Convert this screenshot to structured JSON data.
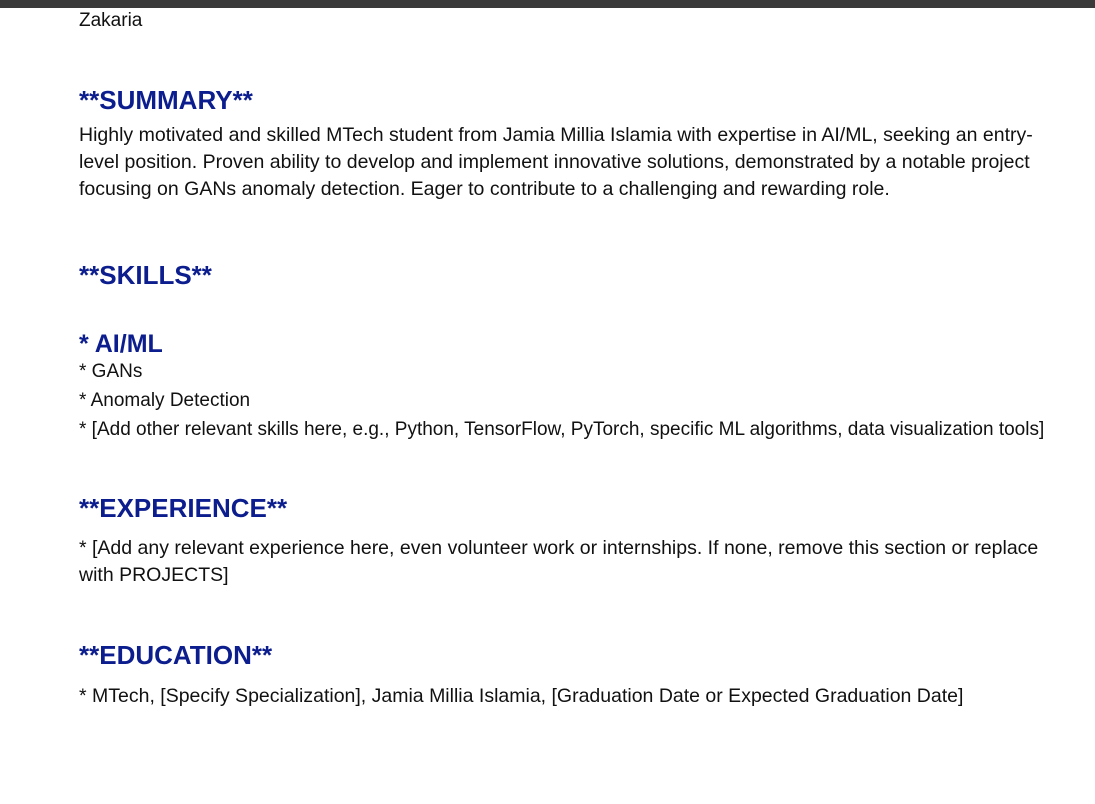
{
  "header": {
    "name": "Zakaria"
  },
  "summary": {
    "heading": "**SUMMARY**",
    "text": "Highly motivated and skilled MTech student from Jamia Millia Islamia with expertise in AI/ML, seeking an entry-level position. Proven ability to develop and implement innovative solutions, demonstrated by a notable project focusing on GANs anomaly detection. Eager to contribute to a challenging and rewarding role."
  },
  "skills": {
    "heading": "**SKILLS**",
    "category": "* AI/ML",
    "items": [
      "* GANs",
      "* Anomaly Detection",
      "* [Add other relevant skills here, e.g., Python, TensorFlow, PyTorch, specific ML algorithms, data visualization tools]"
    ]
  },
  "experience": {
    "heading": "**EXPERIENCE**",
    "text": "* [Add any relevant experience here, even volunteer work or internships. If none, remove this section or replace with PROJECTS]"
  },
  "education": {
    "heading": "**EDUCATION**",
    "text": "* MTech, [Specify Specialization], Jamia Millia Islamia, [Graduation Date or Expected Graduation Date]"
  },
  "colors": {
    "heading": "#0c1d8e",
    "topbar": "#3a3a3a"
  }
}
